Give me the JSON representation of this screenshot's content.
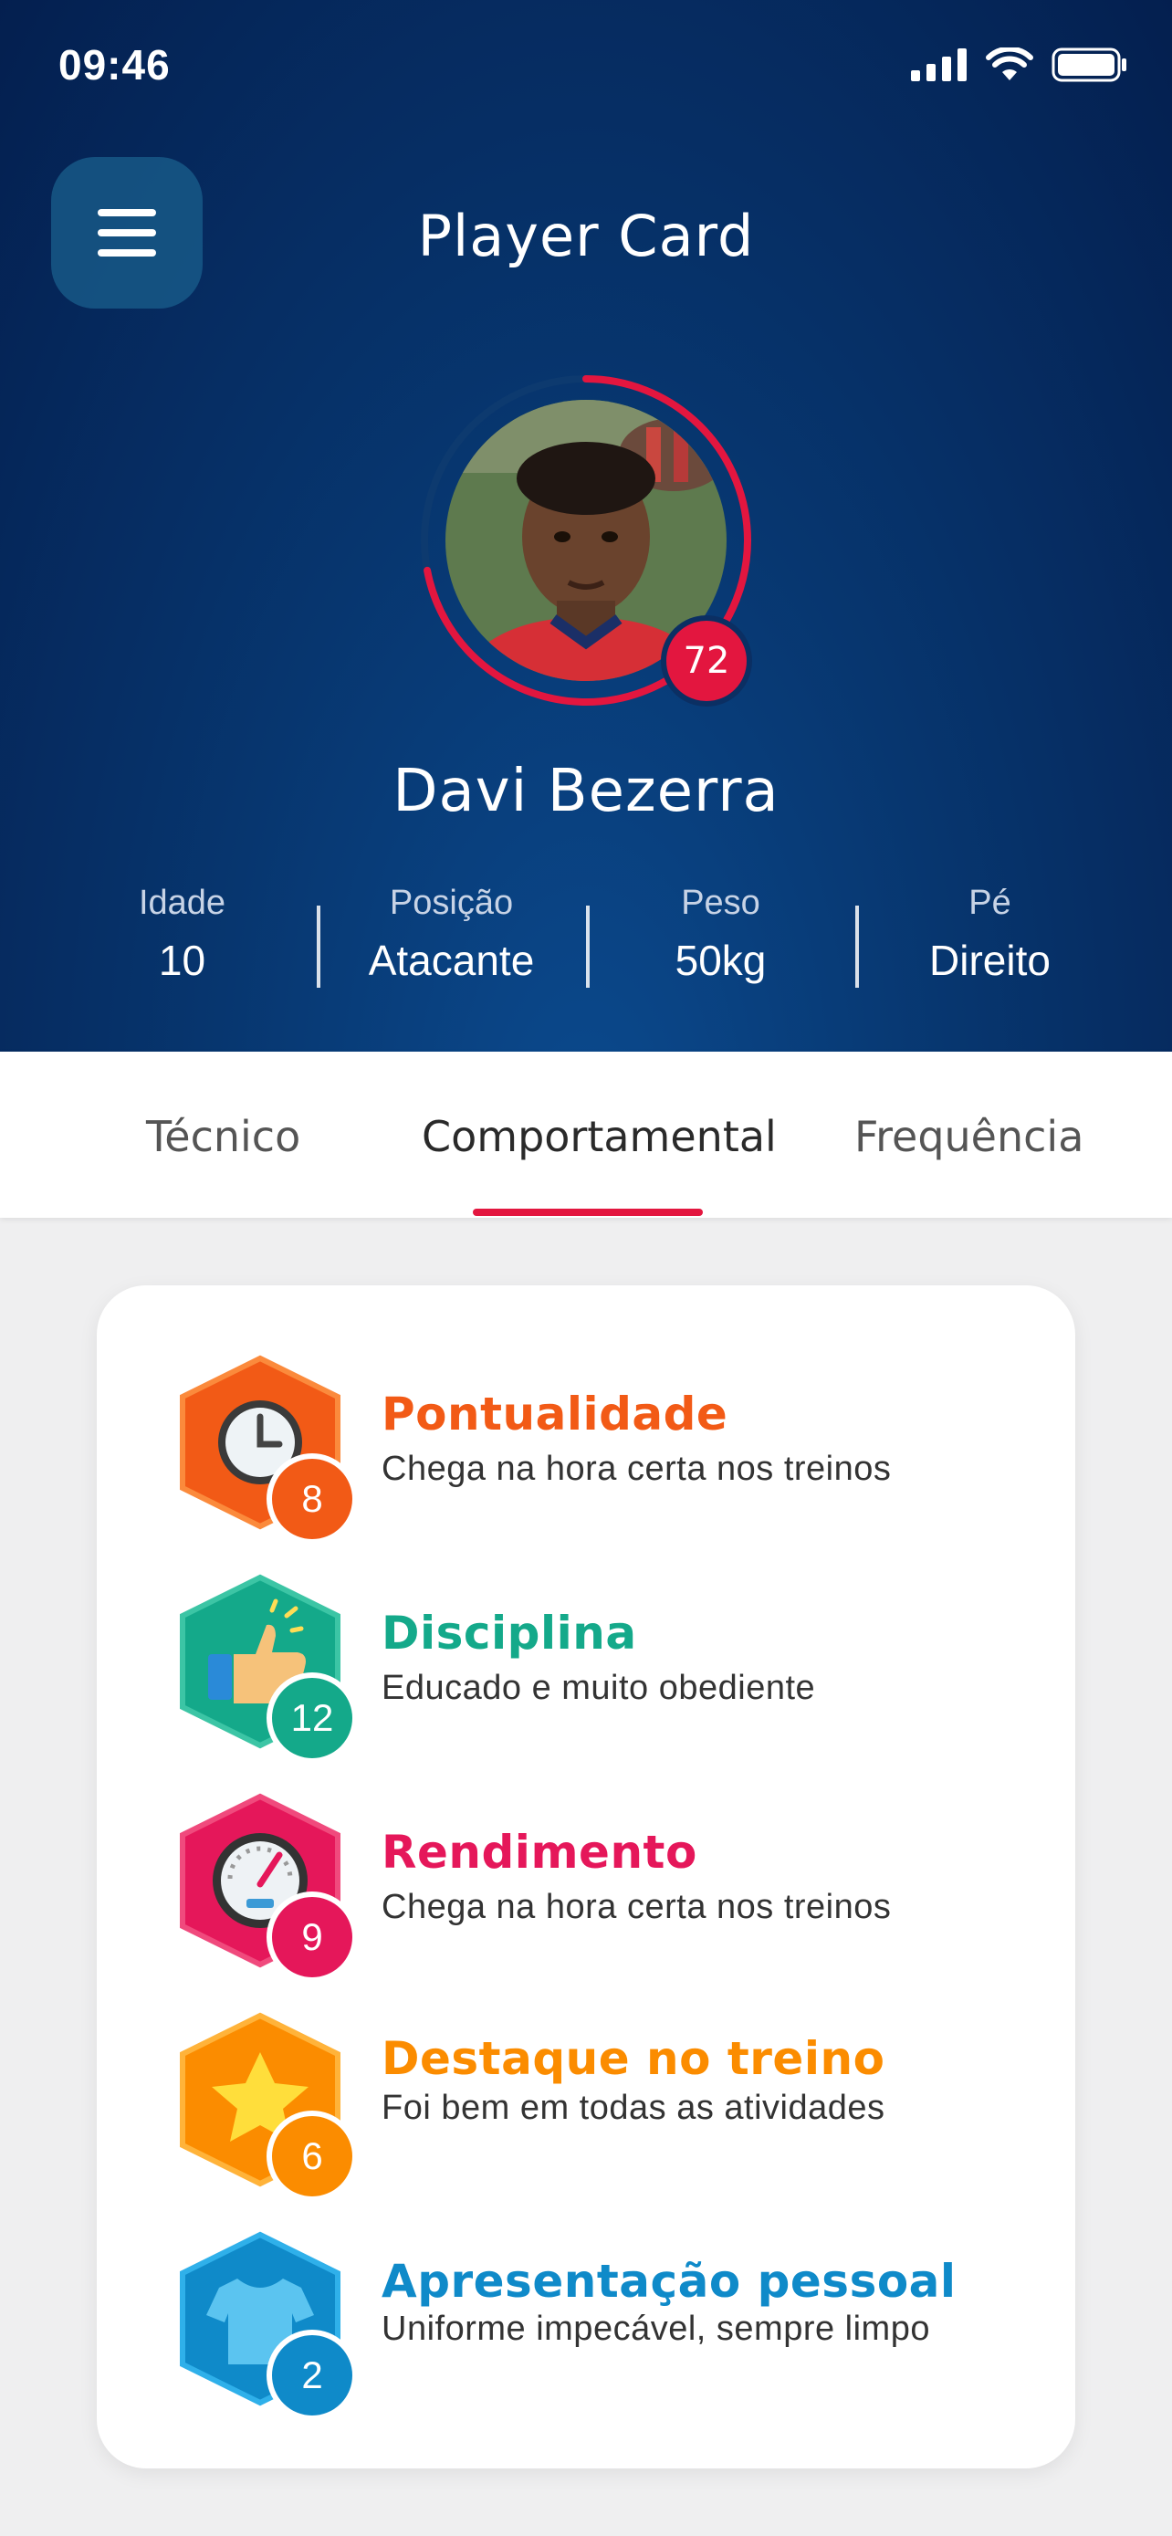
{
  "status_bar": {
    "time": "09:46"
  },
  "header": {
    "title": "Player Card"
  },
  "player": {
    "name": "Davi Bezerra",
    "score": "72",
    "score_fraction": 0.72,
    "stats": [
      {
        "label": "Idade",
        "value": "10"
      },
      {
        "label": "Posição",
        "value": "Atacante"
      },
      {
        "label": "Peso",
        "value": "50kg"
      },
      {
        "label": "Pé",
        "value": "Direito"
      }
    ]
  },
  "tabs": [
    {
      "label": "Técnico",
      "active": false
    },
    {
      "label": "Comportamental",
      "active": true
    },
    {
      "label": "Frequência",
      "active": false
    }
  ],
  "behaviours": [
    {
      "title": "Pontualidade",
      "description": "Chega na hora certa nos treinos",
      "count": "8",
      "color": "#f25a16",
      "icon": "clock-icon"
    },
    {
      "title": "Disciplina",
      "description": "Educado e muito obediente",
      "count": "12",
      "color": "#14a98a",
      "icon": "thumbs-up-icon"
    },
    {
      "title": "Rendimento",
      "description": "Chega na hora certa nos treinos",
      "count": "9",
      "color": "#e5175a",
      "icon": "speedometer-icon"
    },
    {
      "title": "Destaque no treino",
      "description": "Foi bem em todas as atividades",
      "count": "6",
      "color": "#fb8c00",
      "icon": "star-icon"
    },
    {
      "title": "Apresentação pessoal",
      "description": "Uniforme impecável, sempre limpo",
      "count": "2",
      "color": "#0f8ac9",
      "icon": "shirt-icon"
    }
  ],
  "colors": {
    "accent": "#e3163f",
    "header_dark": "#041f4f",
    "header_light": "#0b4a8e"
  }
}
